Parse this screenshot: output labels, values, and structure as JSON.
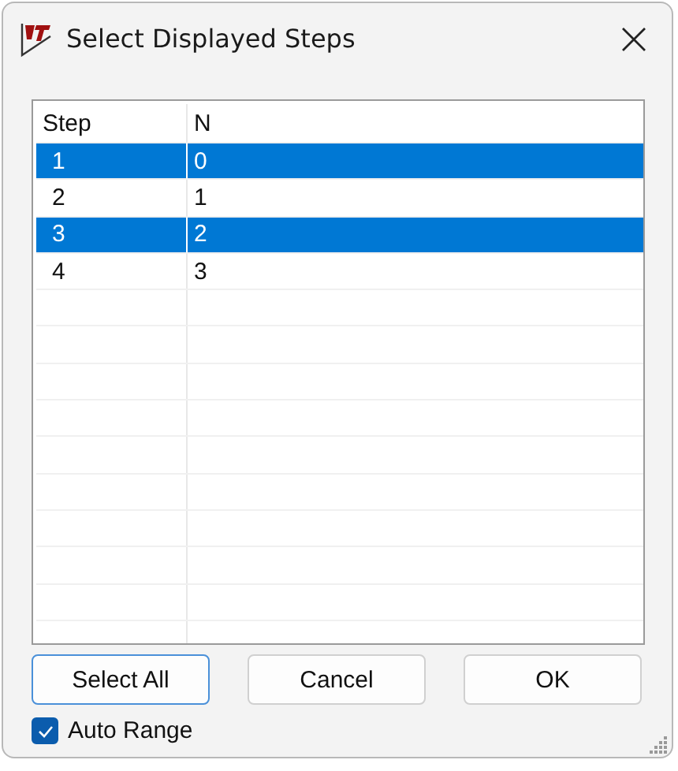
{
  "window": {
    "title": "Select Displayed Steps"
  },
  "table": {
    "columns": [
      "Step",
      "N"
    ],
    "rows": [
      {
        "cells": [
          "1",
          "0"
        ],
        "selected": true
      },
      {
        "cells": [
          "2",
          "1"
        ],
        "selected": false
      },
      {
        "cells": [
          "3",
          "2"
        ],
        "selected": true
      },
      {
        "cells": [
          "4",
          "3"
        ],
        "selected": false
      }
    ]
  },
  "buttons": [
    {
      "label": "Select All",
      "focused": true
    },
    {
      "label": "Cancel",
      "focused": false
    },
    {
      "label": "OK",
      "focused": false
    }
  ],
  "auto_range": {
    "label": "Auto Range",
    "checked": true
  }
}
